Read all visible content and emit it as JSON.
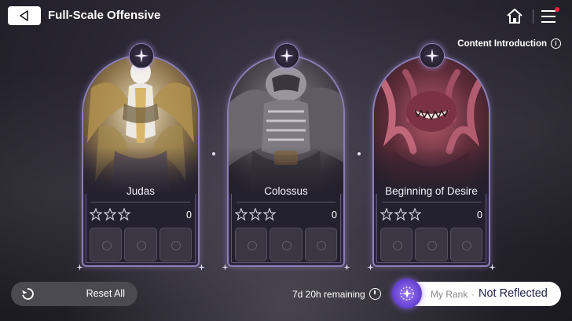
{
  "header": {
    "title": "Full-Scale Offensive",
    "content_intro": "Content Introduction",
    "notification_color": "#e8273a"
  },
  "cards": [
    {
      "name": "Judas",
      "stars_earned": 0,
      "stars_total": 3,
      "score": "0",
      "slots": 3
    },
    {
      "name": "Colossus",
      "stars_earned": 0,
      "stars_total": 3,
      "score": "0",
      "slots": 3
    },
    {
      "name": "Beginning of Desire",
      "stars_earned": 0,
      "stars_total": 3,
      "score": "0",
      "slots": 3
    }
  ],
  "footer": {
    "reset_label": "Reset All",
    "remaining": "7d 20h remaining",
    "rank_label": "My Rank",
    "rank_sep": "·",
    "rank_value": "Not Reflected"
  },
  "colors": {
    "frame_accent": "#8b7fb5",
    "rank_badge": "#7b58e4"
  },
  "icons": [
    "back-arrow-icon",
    "home-icon",
    "menu-icon",
    "info-icon",
    "star-outline-icon",
    "reset-icon",
    "clock-icon",
    "rank-emblem-icon",
    "crest-star-icon"
  ]
}
